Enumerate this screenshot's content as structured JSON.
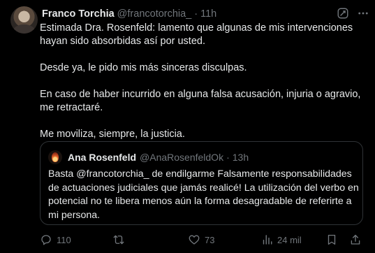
{
  "tweet": {
    "author_name": "Franco Torchia",
    "author_handle": "@francotorchia_",
    "separator": "·",
    "time": "11h",
    "paragraphs": [
      "Estimada Dra. Rosenfeld:  lamento que algunas de mis intervenciones hayan sido absorbidas así por usted.",
      "Desde ya, le pido mis más sinceras disculpas.",
      "En caso de haber incurrido en alguna falsa acusación, injuria o agravio, me retractaré.",
      "Me moviliza, siempre, la justicia."
    ]
  },
  "quote": {
    "author_name": "Ana Rosenfeld",
    "author_handle": "@AnaRosenfeldOk",
    "separator": "·",
    "time": "13h",
    "text": "Basta @francotorchia_ de endilgarme Falsamente  responsabilidades de actuaciones judiciales que jamás realicé!  La utilización del verbo en potencial no te libera  menos aún la forma desagradable de referirte a mi persona."
  },
  "actions": {
    "replies": "110",
    "retweets": "",
    "likes": "73",
    "views": "24 mil"
  },
  "icons": {
    "grok": "grok-icon",
    "more": "more-icon",
    "reply": "reply-icon",
    "retweet": "retweet-icon",
    "like": "heart-icon",
    "views": "views-icon",
    "bookmark": "bookmark-icon",
    "share": "share-icon"
  },
  "colors": {
    "background": "#000000",
    "text_primary": "#e7e9ea",
    "text_secondary": "#71767b",
    "border": "#2f3336"
  }
}
